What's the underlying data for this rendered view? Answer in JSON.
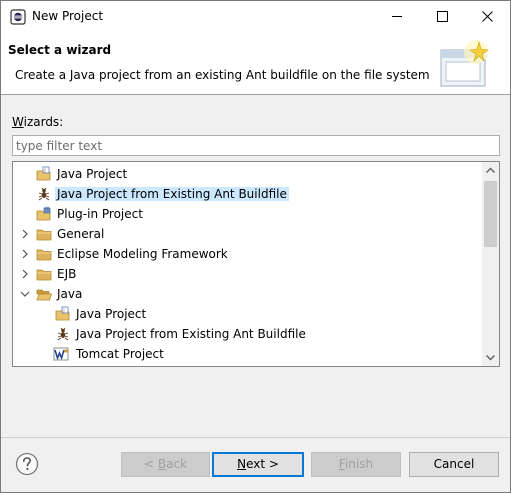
{
  "window": {
    "title": "New Project"
  },
  "banner": {
    "title": "Select a wizard",
    "description": "Create a Java project from an existing Ant buildfile on the file system"
  },
  "wizards": {
    "label_mnemonic": "W",
    "label_rest": "izards:",
    "filter_placeholder": "type filter text",
    "filter_value": ""
  },
  "tree": {
    "items": [
      {
        "label": "Java Project",
        "icon": "java-project-icon",
        "expandable": false,
        "expanded": false,
        "selected": false
      },
      {
        "label": "Java Project from Existing Ant Buildfile",
        "icon": "ant-icon",
        "expandable": false,
        "expanded": false,
        "selected": true
      },
      {
        "label": "Plug-in Project",
        "icon": "plugin-project-icon",
        "expandable": false,
        "expanded": false,
        "selected": false
      },
      {
        "label": "General",
        "icon": "folder-icon",
        "expandable": true,
        "expanded": false,
        "selected": false
      },
      {
        "label": "Eclipse Modeling Framework",
        "icon": "folder-icon",
        "expandable": true,
        "expanded": false,
        "selected": false
      },
      {
        "label": "EJB",
        "icon": "folder-icon",
        "expandable": true,
        "expanded": false,
        "selected": false
      },
      {
        "label": "Java",
        "icon": "folder-icon",
        "expandable": true,
        "expanded": true,
        "selected": false
      },
      {
        "label": "Java Project",
        "icon": "java-project-icon",
        "expandable": false,
        "expanded": false,
        "selected": false
      },
      {
        "label": "Java Project from Existing Ant Buildfile",
        "icon": "ant-icon",
        "expandable": false,
        "expanded": false,
        "selected": false
      },
      {
        "label": "Tomcat Project",
        "icon": "tomcat-icon",
        "expandable": false,
        "expanded": false,
        "selected": false
      }
    ]
  },
  "buttons": {
    "back_prefix": "< ",
    "back_mnemonic": "B",
    "back_rest": "ack",
    "next_mnemonic": "N",
    "next_rest": "ext >",
    "finish_mnemonic": "F",
    "finish_rest": "inish",
    "cancel": "Cancel"
  },
  "colors": {
    "selection": "#cce8ff",
    "default_button_border": "#0078d7",
    "folder": "#dcb35c"
  }
}
